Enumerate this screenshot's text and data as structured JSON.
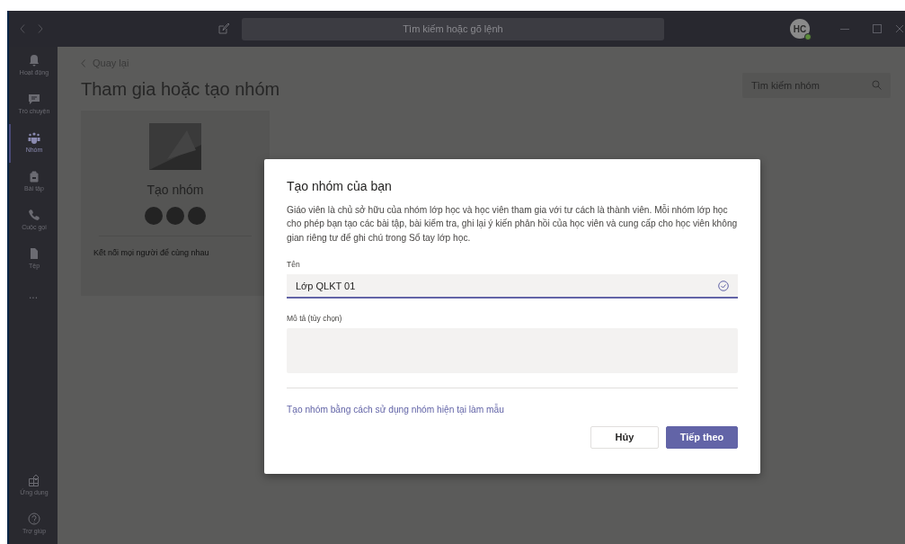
{
  "title_bar": {
    "search_placeholder": "Tìm kiếm hoặc gõ lệnh",
    "avatar_initials": "HC",
    "presence_online": true
  },
  "sidebar": {
    "items": [
      {
        "label": "Hoạt động",
        "selected": false
      },
      {
        "label": "Trò chuyện",
        "selected": false
      },
      {
        "label": "Nhóm",
        "selected": true
      },
      {
        "label": "Bài tập",
        "selected": false
      },
      {
        "label": "Cuộc gọi",
        "selected": false
      },
      {
        "label": "Tệp",
        "selected": false
      }
    ],
    "more": "...",
    "bottom_items": [
      {
        "label": "Ứng dụng",
        "selected": false
      },
      {
        "label": "Trợ giúp",
        "selected": false
      }
    ]
  },
  "main": {
    "back": "Quay lại",
    "title": "Tham gia hoặc tạo nhóm",
    "search_placeholder": "Tìm kiếm nhóm",
    "card": {
      "title": "Tạo nhóm",
      "caption": "Kết nối mọi người để cùng nhau"
    }
  },
  "dialog": {
    "title": "Tạo nhóm của bạn",
    "description": "Giáo viên là chủ sở hữu của nhóm lớp học và học viên tham gia với tư cách là thành viên. Mỗi nhóm lớp học cho phép bạn tạo các bài tập, bài kiểm tra, ghi lại ý kiến phản hồi của học viên và cung cấp cho học viên không gian riêng tư để ghi chú trong Sổ tay lớp học.",
    "name_label": "Tên",
    "name_value": "Lớp QLKT 01",
    "name_valid": true,
    "description_label": "Mô tả (tùy chọn)",
    "template_link": "Tạo nhóm bằng cách sử dụng nhóm hiện tại làm mẫu",
    "buttons": [
      {
        "label": "Hủy",
        "kind": "secondary"
      },
      {
        "label": "Tiếp theo",
        "kind": "primary"
      }
    ]
  }
}
